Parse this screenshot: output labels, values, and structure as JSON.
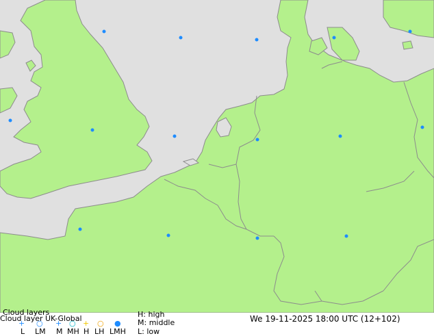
{
  "map": {
    "colors": {
      "sea": "#e0e0e0",
      "land": "#b4f08c",
      "border": "#8c8c8c",
      "coast": "#8c8c8c",
      "marker": "#1e8cff"
    }
  },
  "legend": {
    "title": "Cloud layers",
    "product": "Cloud layer  UK-Global",
    "valid_time": "We 19-11-2025 18:00 UTC (12+102)",
    "level_labels": [
      "L",
      "LM",
      "M",
      "MH",
      "H",
      "LH",
      "LMH"
    ],
    "level_colors": [
      "#1e8cff",
      "#1e8cff",
      "#1e8cff",
      "#00b4c8",
      "#f0c800",
      "#f0a000",
      "#1e8cff"
    ],
    "key": [
      "H: high",
      "M: middle",
      "L: low"
    ]
  }
}
